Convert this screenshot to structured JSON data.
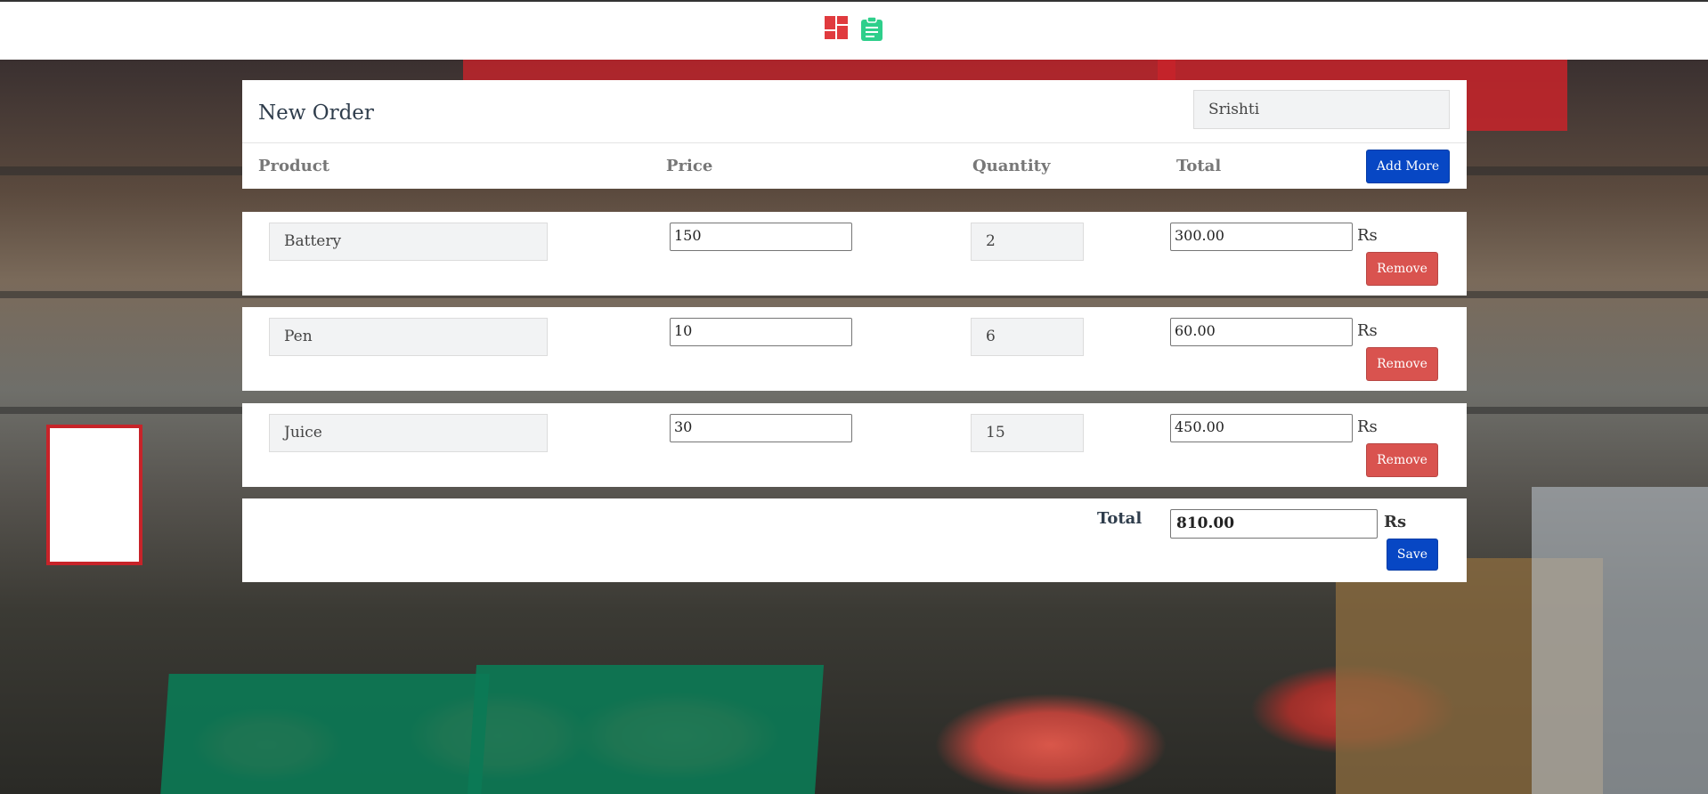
{
  "nav": {
    "dashboard_icon": "dashboard-icon",
    "orders_icon": "clipboard-icon"
  },
  "order": {
    "title": "New Order",
    "customer": "Srishti",
    "columns": {
      "product": "Product",
      "price": "Price",
      "quantity": "Quantity",
      "total": "Total"
    },
    "add_more_label": "Add More",
    "items": [
      {
        "product": "Battery",
        "price": "150",
        "quantity": "2",
        "total": "300.00",
        "currency": "Rs",
        "remove_label": "Remove"
      },
      {
        "product": "Pen",
        "price": "10",
        "quantity": "6",
        "total": "60.00",
        "currency": "Rs",
        "remove_label": "Remove"
      },
      {
        "product": "Juice",
        "price": "30",
        "quantity": "15",
        "total": "450.00",
        "currency": "Rs",
        "remove_label": "Remove"
      }
    ],
    "grand_total_label": "Total",
    "grand_total": "810.00",
    "grand_total_currency": "Rs",
    "save_label": "Save"
  },
  "colors": {
    "primary_blue": "#0747c4",
    "danger_red": "#d9534f",
    "dashboard_icon": "#e03a3e",
    "clipboard_icon": "#2ecf8b"
  }
}
